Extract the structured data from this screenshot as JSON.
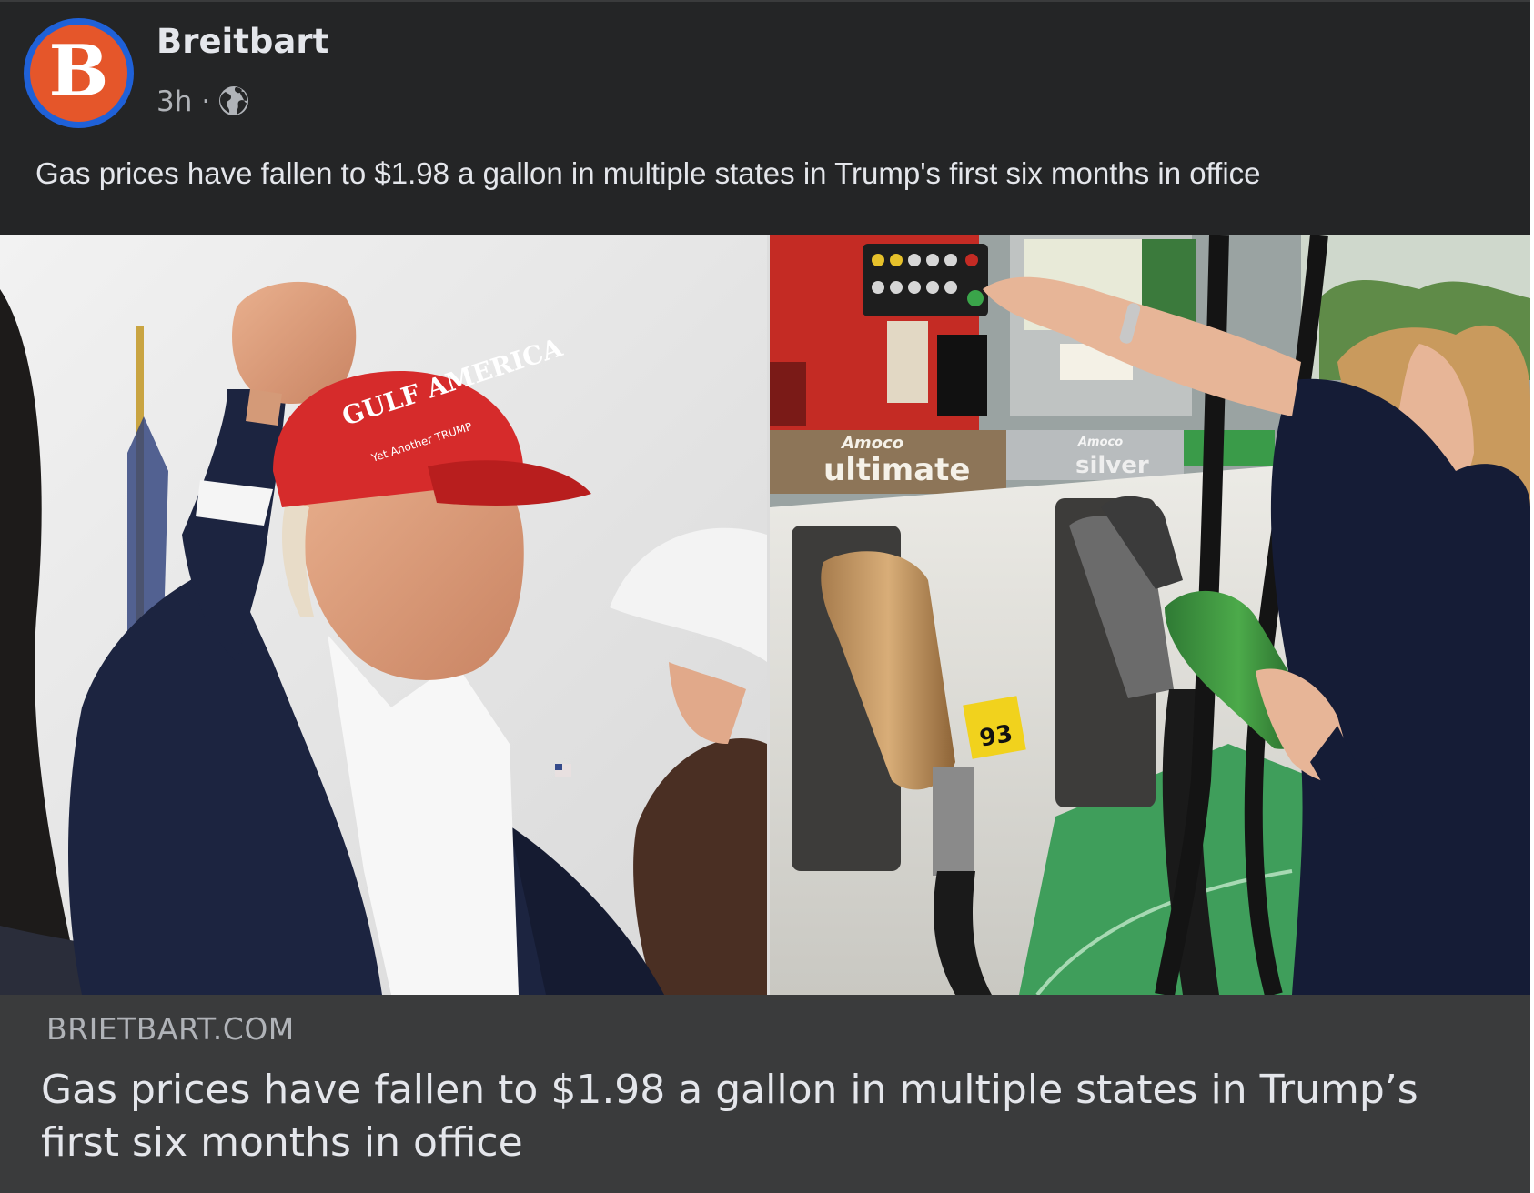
{
  "post": {
    "author": "Breitbart",
    "avatar_letter": "B",
    "time": "3h",
    "separator": "·",
    "audience_icon": "globe-icon",
    "caption": "Gas prices have fallen to $1.98 a gallon in multiple states in Trump's first six months in office"
  },
  "image": {
    "left_hat_text": "GULF AMERICA",
    "left_hat_subtext": "Yet Another TRUMP",
    "pump_brand_left": "Amoco",
    "pump_grade_left": "ultimate",
    "pump_brand_mid": "Amoco",
    "pump_grade_mid": "silver",
    "pump_octane": "93"
  },
  "link_preview": {
    "domain": "BRIETBART.COM",
    "headline": "Gas prices have fallen to $1.98 a gallon in multiple states in Trump’s first six months in office"
  },
  "colors": {
    "background": "#242526",
    "link_box": "#3a3b3c",
    "text_primary": "#e4e6eb",
    "text_secondary": "#b0b3b8",
    "avatar_ring": "#1f61d8",
    "avatar_fill": "#e5562a"
  }
}
